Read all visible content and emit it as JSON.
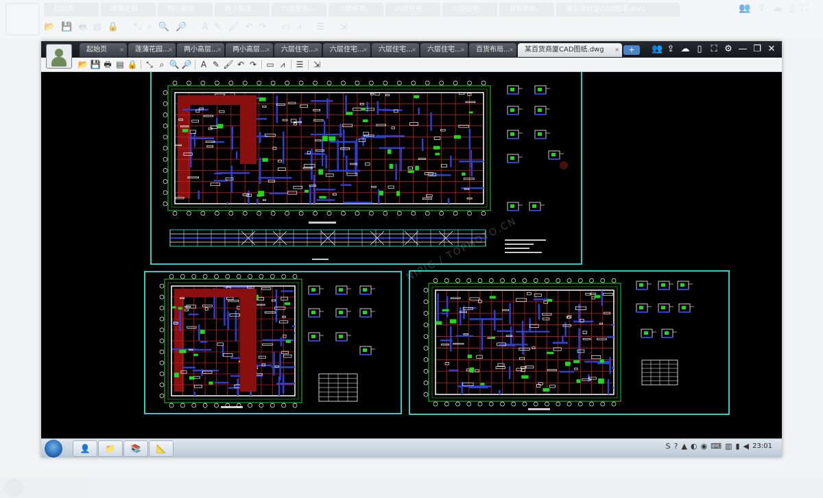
{
  "background_ui": {
    "tabs": [
      "起始页",
      "莲蒲花园…",
      "两小高层…",
      "两小高层…",
      "六层住宅…",
      "六层住宅…",
      "六层住宅…",
      "六层住宅…",
      "百货布局…",
      "某百货商厦CAD图纸.dwg"
    ]
  },
  "window": {
    "tabs": [
      {
        "label": "起始页"
      },
      {
        "label": "莲蒲花园..."
      },
      {
        "label": "两小高层..."
      },
      {
        "label": "两小高层..."
      },
      {
        "label": "六层住宅..."
      },
      {
        "label": "六层住宅..."
      },
      {
        "label": "六层住宅..."
      },
      {
        "label": "六层住宅..."
      },
      {
        "label": "百货布局..."
      },
      {
        "label": "某百货商厦CAD图纸.dwg",
        "active": true
      }
    ],
    "tab_add_label": "+",
    "tab_close_glyph": "×",
    "controls": [
      {
        "name": "user-group-icon",
        "glyph": "👥"
      },
      {
        "name": "share-icon",
        "glyph": "⇪"
      },
      {
        "name": "cloud-icon",
        "glyph": "☁"
      },
      {
        "name": "phone-icon",
        "glyph": "▯"
      },
      {
        "name": "fullscreen-icon",
        "glyph": "⛶"
      },
      {
        "name": "settings-icon",
        "glyph": "⚙"
      },
      {
        "name": "minimize-icon",
        "glyph": "—"
      },
      {
        "name": "restore-icon",
        "glyph": "❐"
      },
      {
        "name": "close-icon",
        "glyph": "✕"
      }
    ]
  },
  "toolbar": {
    "tools": [
      {
        "name": "open-icon",
        "glyph": "📂"
      },
      {
        "name": "save-icon",
        "glyph": "💾"
      },
      {
        "name": "print-icon",
        "glyph": "🖶"
      },
      {
        "name": "pdf-icon",
        "glyph": "▤"
      },
      {
        "name": "lock-icon",
        "glyph": "🔒"
      },
      {
        "sep": true
      },
      {
        "name": "zoom-extent-icon",
        "glyph": "⤡"
      },
      {
        "name": "zoom-window-icon",
        "glyph": "⌕"
      },
      {
        "name": "zoom-in-icon",
        "glyph": "🔍"
      },
      {
        "name": "zoom-out-icon",
        "glyph": "🔎"
      },
      {
        "sep": true
      },
      {
        "name": "text-icon",
        "glyph": "A"
      },
      {
        "name": "pencil-icon",
        "glyph": "✎"
      },
      {
        "name": "brush-icon",
        "glyph": "🖌"
      },
      {
        "name": "undo-icon",
        "glyph": "↶"
      },
      {
        "name": "redo-icon",
        "glyph": "↷"
      },
      {
        "sep": true
      },
      {
        "name": "measure-icon",
        "glyph": "▭"
      },
      {
        "name": "dimension-icon",
        "glyph": "⩘"
      },
      {
        "sep": true
      },
      {
        "name": "layers-icon",
        "glyph": "☰"
      },
      {
        "sep": true
      },
      {
        "name": "export-icon",
        "glyph": "⇲"
      }
    ]
  },
  "taskbar": {
    "apps": [
      {
        "name": "taskbar-app-user",
        "glyph": "👤"
      },
      {
        "name": "taskbar-app-explorer",
        "glyph": "📁"
      },
      {
        "name": "taskbar-app-books",
        "glyph": "📚"
      },
      {
        "name": "taskbar-app-cad",
        "glyph": "📐"
      }
    ],
    "tray_icons": [
      "S",
      "?",
      "▲",
      "◐",
      "◉",
      "⌨",
      "▥",
      "▮",
      "◀"
    ],
    "clock": "23:01"
  },
  "watermark": "NIPIC / TOPHOTO.CN",
  "colors": {
    "canvas": "#000000",
    "frame": "#2ad0c8",
    "grid": "#c22020",
    "wall": "#2f3fd0",
    "green": "#1fd81f",
    "white": "#ffffff"
  }
}
